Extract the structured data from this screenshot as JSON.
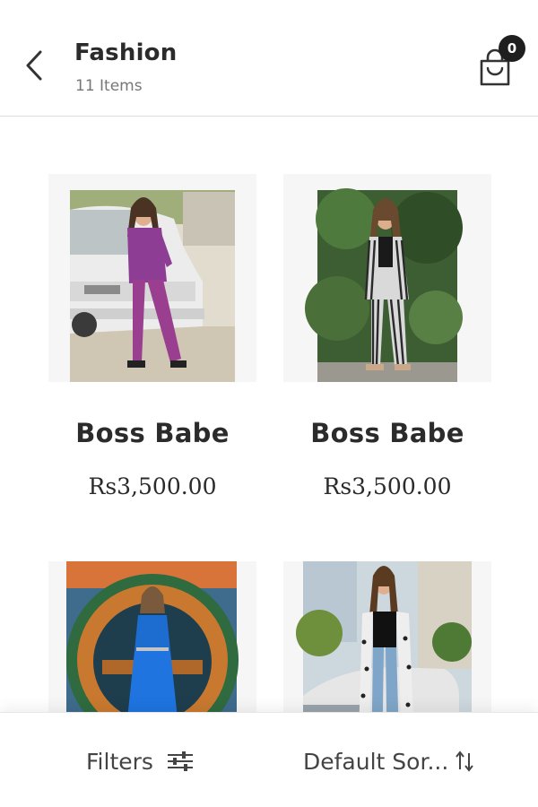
{
  "header": {
    "title": "Fashion",
    "item_count": "11 Items",
    "cart_count": "0"
  },
  "icons": {
    "back": "chevron-left-icon",
    "cart": "shopping-bag-icon",
    "filters": "sliders-icon",
    "sort": "sort-arrows-icon"
  },
  "products": [
    {
      "name": "Boss Babe",
      "price": "Rs3,500.00"
    },
    {
      "name": "Boss Babe",
      "price": "Rs3,500.00"
    },
    {
      "name": "",
      "price": ""
    },
    {
      "name": "",
      "price": ""
    }
  ],
  "bottom_bar": {
    "filters_label": "Filters",
    "sort_label": "Default Sor..."
  },
  "colors": {
    "text": "#2b2b2b",
    "badge": "#1f1f1f",
    "divider": "#dcdcdc"
  }
}
